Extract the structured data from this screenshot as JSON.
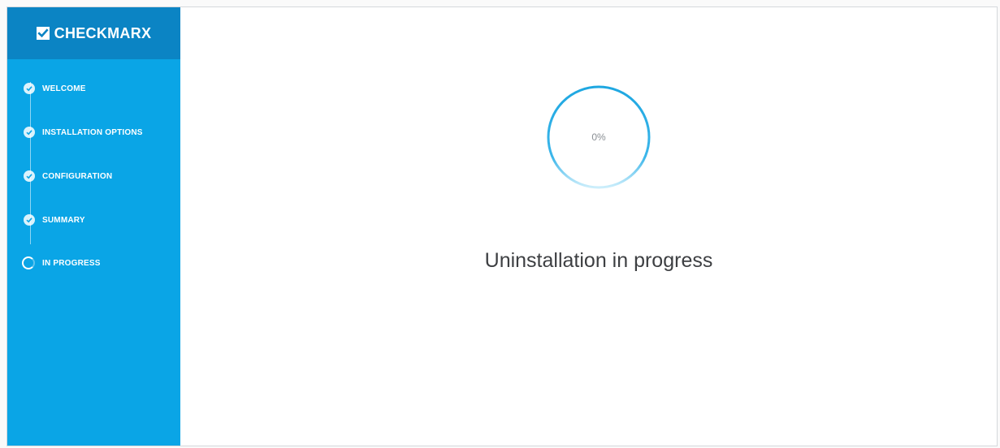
{
  "brand": {
    "name": "CHECKMARX"
  },
  "sidebar": {
    "steps": [
      {
        "label": "WELCOME",
        "state": "done",
        "icon": "check-icon"
      },
      {
        "label": "INSTALLATION OPTIONS",
        "state": "done",
        "icon": "check-icon"
      },
      {
        "label": "CONFIGURATION",
        "state": "done",
        "icon": "check-icon"
      },
      {
        "label": "SUMMARY",
        "state": "done",
        "icon": "check-icon"
      },
      {
        "label": "IN PROGRESS",
        "state": "active",
        "icon": "spinner-icon"
      }
    ]
  },
  "main": {
    "progress": {
      "value_text": "0%",
      "value": 0
    },
    "status_text": "Uninstallation in progress"
  },
  "colors": {
    "sidebar": "#0aa5e6",
    "brand_bar": "#0b84c4",
    "accent": "#1ea7e1"
  }
}
